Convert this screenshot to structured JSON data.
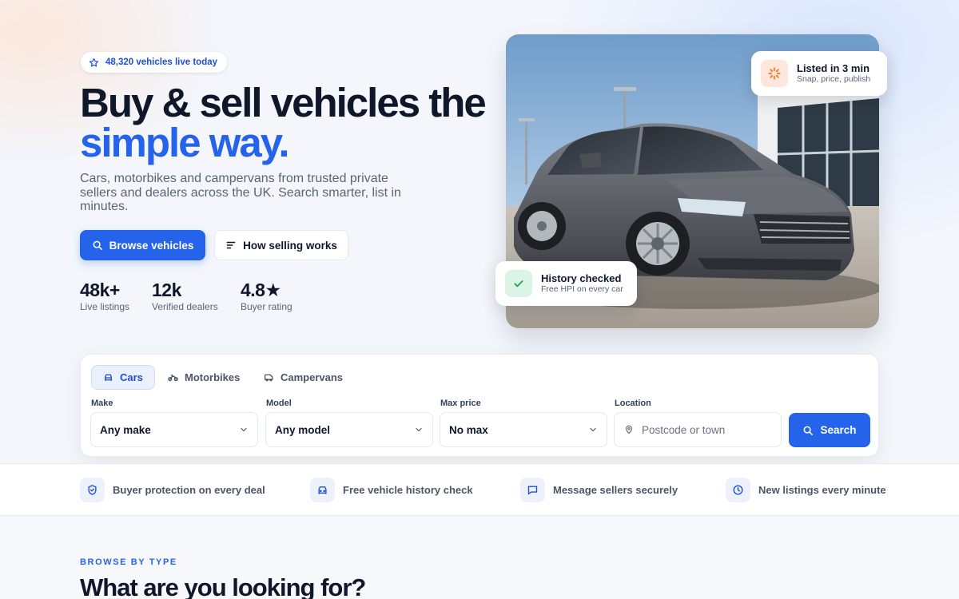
{
  "colors": {
    "primary": "#2563eb",
    "text": "#0f172a",
    "muted": "#5b6475",
    "listed_icon": "#f97316",
    "history_icon": "#16a34a"
  },
  "hero": {
    "badge_text": "48,320 vehicles live today",
    "badge_icon": "star-icon",
    "headline_line1": "Buy & sell vehicles the",
    "headline_line2": "simple way.",
    "subtitle": "Cars, motorbikes and campervans from trusted private sellers and dealers across the UK. Search smarter, list in minutes.",
    "primary_button": "Browse vehicles",
    "secondary_button": "How selling works",
    "stats": [
      {
        "value": "48k+",
        "label": "Live listings"
      },
      {
        "value": "12k",
        "label": "Verified dealers"
      },
      {
        "value": "4.8★",
        "label": "Buyer rating"
      }
    ]
  },
  "photo_cards": {
    "listed": {
      "title": "Listed in 3 min",
      "subtitle": "Snap, price, publish",
      "icon": "spinner-icon"
    },
    "history": {
      "title": "History checked",
      "subtitle": "Free HPI on every car",
      "icon": "check-icon"
    }
  },
  "search": {
    "tabs": [
      {
        "label": "Cars",
        "icon": "car-icon",
        "active": true
      },
      {
        "label": "Motorbikes",
        "icon": "motorbike-icon",
        "active": false
      },
      {
        "label": "Campervans",
        "icon": "campervan-icon",
        "active": false
      }
    ],
    "make": {
      "label": "Make",
      "value": "Any make"
    },
    "model": {
      "label": "Model",
      "value": "Any model"
    },
    "max_price": {
      "label": "Max price",
      "value": "No max"
    },
    "location": {
      "label": "Location",
      "placeholder": "Postcode or town"
    },
    "button": "Search"
  },
  "features": [
    {
      "icon": "shield-icon",
      "label": "Buyer protection on every deal"
    },
    {
      "icon": "car-front-icon",
      "label": "Free vehicle history check"
    },
    {
      "icon": "message-icon",
      "label": "Message sellers securely"
    },
    {
      "icon": "clock-icon",
      "label": "New listings every minute"
    }
  ],
  "section": {
    "eyebrow": "BROWSE BY TYPE",
    "title": "What are you looking for?"
  }
}
